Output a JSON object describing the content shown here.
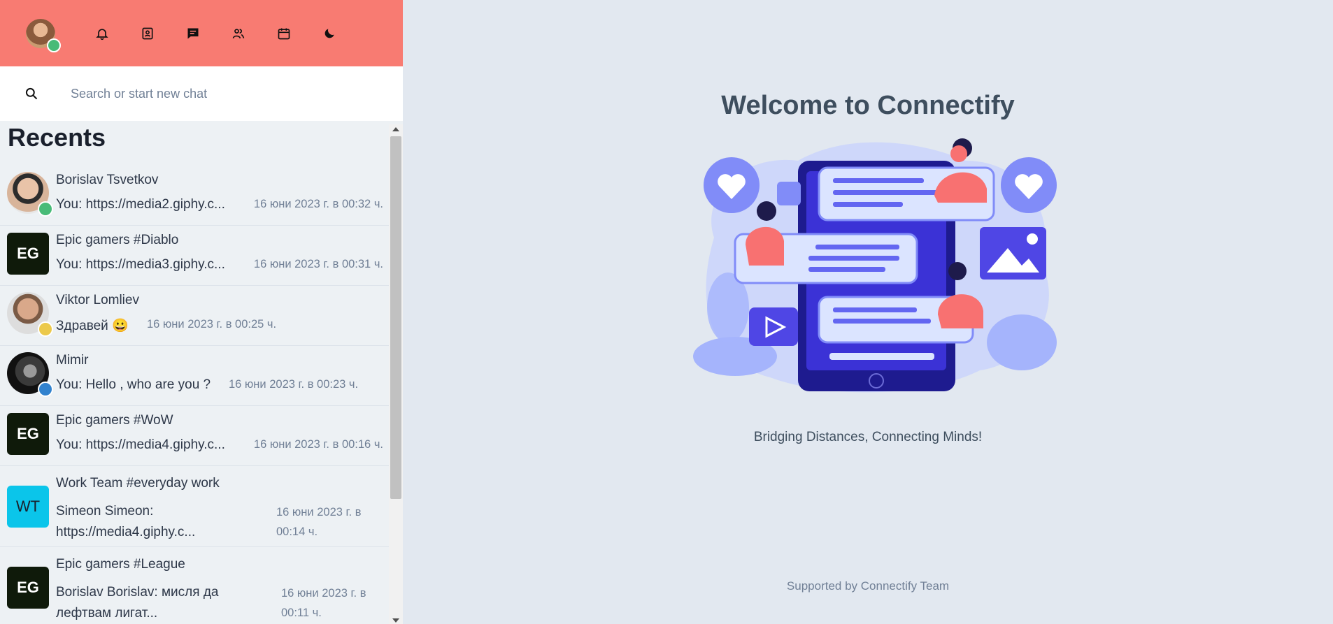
{
  "header": {
    "nav_icons": [
      "bell-icon",
      "contacts-icon",
      "chat-icon",
      "users-icon",
      "calendar-icon",
      "moon-icon"
    ]
  },
  "search": {
    "placeholder": "Search or start new chat"
  },
  "recents": {
    "title": "Recents",
    "chats": [
      {
        "name": "Borislav Tsvetkov",
        "message": "You: https://media2.giphy.c...",
        "time": "16 юни 2023 г. в 00:32 ч.",
        "status": "#48bb78"
      },
      {
        "name": "Epic gamers #Diablo",
        "initials": "EG",
        "message": "You: https://media3.giphy.c...",
        "time": "16 юни 2023 г. в 00:31 ч."
      },
      {
        "name": "Viktor Lomliev",
        "message": "Здравей 😀",
        "time": "16 юни 2023 г. в 00:25 ч.",
        "status": "#ecc94b"
      },
      {
        "name": "Mimir",
        "message": "You: Hello , who are you ?",
        "time": "16 юни 2023 г. в 00:23 ч.",
        "status": "#3182ce"
      },
      {
        "name": "Epic gamers #WoW",
        "initials": "EG",
        "message": "You: https://media4.giphy.c...",
        "time": "16 юни 2023 г. в 00:16 ч."
      },
      {
        "name": "Work Team #everyday work",
        "initials": "WT",
        "message": "Simeon Simeon: https://media4.giphy.c...",
        "time": "16 юни 2023 г. в 00:14 ч."
      },
      {
        "name": "Epic gamers #League",
        "initials": "EG",
        "message": "Borislav Borislav: мисля да лефтвам лигат...",
        "time": "16 юни 2023 г. в 00:11 ч."
      }
    ]
  },
  "main": {
    "welcome": "Welcome to Connectify",
    "tagline": "Bridging Distances, Connecting Minds!",
    "footer": "Supported by Connectify Team"
  },
  "colors": {
    "header_bg": "#f87b72",
    "group_dark": "#0f1a0a",
    "group_cyan": "#0bc5ea",
    "accent": "#4338ca"
  }
}
